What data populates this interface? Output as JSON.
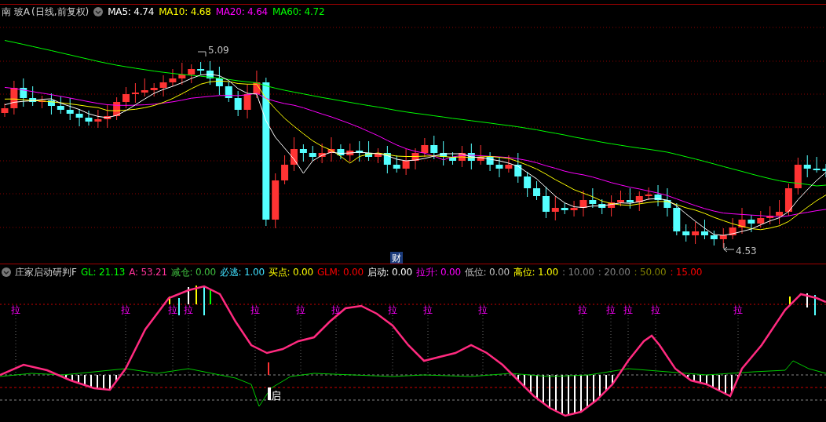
{
  "header": {
    "stock": "南 玻A",
    "period": "(日线,前复权)",
    "ma": [
      {
        "label": "MA5: 4.74",
        "color": "#ffffff"
      },
      {
        "label": "MA10: 4.68",
        "color": "#ffff00"
      },
      {
        "label": "MA20: 4.64",
        "color": "#ff00ff"
      },
      {
        "label": "MA60: 4.72",
        "color": "#00ff00"
      }
    ]
  },
  "price_chart": {
    "high_label": "5.09",
    "low_label": "4.53",
    "finance_marker": "财"
  },
  "indicator": {
    "name": "庄家启动研判F",
    "items": [
      {
        "text": "GL: 21.13",
        "color": "#00ff00"
      },
      {
        "text": "A: 53.21",
        "color": "#ff3399"
      },
      {
        "text": "减仓: 0.00",
        "color": "#40c040"
      },
      {
        "text": "必逃: 1.00",
        "color": "#40e0ff"
      },
      {
        "text": "买点: 0.00",
        "color": "#ffff00"
      },
      {
        "text": "GLM: 0.00",
        "color": "#ff0000"
      },
      {
        "text": "启动: 0.00",
        "color": "#ffffff"
      },
      {
        "text": "拉升: 0.00",
        "color": "#ff00ff"
      },
      {
        "text": "低位: 0.00",
        "color": "#c0c0c0"
      },
      {
        "text": "高位: 1.00",
        "color": "#ffff00"
      },
      {
        "text": ": 10.00",
        "color": "#808080"
      },
      {
        "text": ": 20.00",
        "color": "#808080"
      },
      {
        "text": ": 50.00",
        "color": "#808000"
      },
      {
        "text": ": 15.00",
        "color": "#ff0000"
      }
    ],
    "pull_markers": [
      "拉",
      "拉",
      "拉",
      "拉",
      "拉",
      "拉",
      "拉",
      "拉",
      "拉",
      "拉",
      "拉",
      "拉",
      "拉",
      "拉",
      "拉"
    ],
    "start_marker": "启"
  }
}
